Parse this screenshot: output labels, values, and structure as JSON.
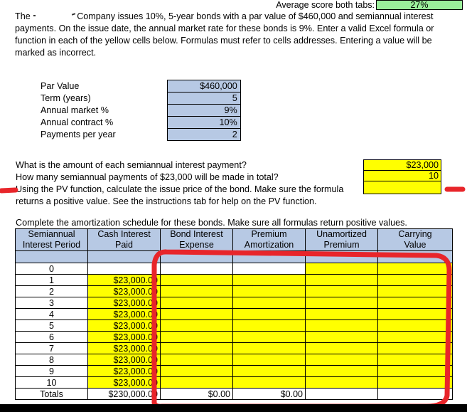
{
  "score_strip": {
    "label": "Average score both tabs:",
    "value": "27%",
    "cell_color": "#9bf09b"
  },
  "intro": {
    "before_name": "The",
    "company_name": "",
    "after_name": "Company issues 10%, 5-year bonds with a par value of $460,000 and semiannual interest payments.  On the issue date, the annual market rate for these bonds is 9%.  Enter a valid Excel formula or function in each of the yellow cells below.  Formulas must refer to cells addresses.  Entering a value will be marked as incorrect."
  },
  "inputs": {
    "rows": [
      {
        "label": "Par Value",
        "value": "$460,000"
      },
      {
        "label": "Term (years)",
        "value": "5"
      },
      {
        "label": "Annual market %",
        "value": "9%"
      },
      {
        "label": "Annual contract %",
        "value": "10%"
      },
      {
        "label": "Payments per year",
        "value": "2"
      }
    ],
    "cell_color": "#b7c9e4"
  },
  "questions": {
    "q1": "What is the amount of each semiannual interest payment?",
    "q2": "How many semiannual payments of $23,000 will be made in total?",
    "q3": "Using the PV function, calculate the issue price of the bond.  Make sure the formula returns a positive value.  See the instructions tab for help on the PV function.",
    "a1": "$23,000",
    "a2": "10",
    "a3": "",
    "cell_color": "#ffff00"
  },
  "amortization": {
    "heading": "Complete the amortization schedule for these bonds.  Make sure all formulas return positive values.",
    "columns": [
      "Semiannual Interest Period",
      "Cash Interest Paid",
      "Bond Interest Expense",
      "Premium Amortization",
      "Unamortized Premium",
      "Carrying Value"
    ],
    "columns_line1": [
      "Semiannual",
      "Cash Interest",
      "Bond Interest",
      "Premium",
      "Unamortized",
      "Carrying"
    ],
    "columns_line2": [
      "Interest Period",
      "Paid",
      "Expense",
      "Amortization",
      "Premium",
      "Value"
    ],
    "rows": [
      {
        "period": "0",
        "cash": "",
        "expense": "",
        "amort": "",
        "unamort": "",
        "carrying": ""
      },
      {
        "period": "1",
        "cash": "$23,000.00",
        "expense": "",
        "amort": "",
        "unamort": "",
        "carrying": ""
      },
      {
        "period": "2",
        "cash": "$23,000.00",
        "expense": "",
        "amort": "",
        "unamort": "",
        "carrying": ""
      },
      {
        "period": "3",
        "cash": "$23,000.00",
        "expense": "",
        "amort": "",
        "unamort": "",
        "carrying": ""
      },
      {
        "period": "4",
        "cash": "$23,000.00",
        "expense": "",
        "amort": "",
        "unamort": "",
        "carrying": ""
      },
      {
        "period": "5",
        "cash": "$23,000.00",
        "expense": "",
        "amort": "",
        "unamort": "",
        "carrying": ""
      },
      {
        "period": "6",
        "cash": "$23,000.00",
        "expense": "",
        "amort": "",
        "unamort": "",
        "carrying": ""
      },
      {
        "period": "7",
        "cash": "$23,000.00",
        "expense": "",
        "amort": "",
        "unamort": "",
        "carrying": ""
      },
      {
        "period": "8",
        "cash": "$23,000.00",
        "expense": "",
        "amort": "",
        "unamort": "",
        "carrying": ""
      },
      {
        "period": "9",
        "cash": "$23,000.00",
        "expense": "",
        "amort": "",
        "unamort": "",
        "carrying": ""
      },
      {
        "period": "10",
        "cash": "$23,000.00",
        "expense": "",
        "amort": "",
        "unamort": "",
        "carrying": ""
      }
    ],
    "totals": {
      "label": "Totals",
      "cash": "$230,000.00",
      "expense": "$0.00",
      "amort": "$0.00",
      "unamort": "",
      "carrying": ""
    },
    "header_color": "#b7c9e4",
    "input_cell_color": "#ffff00"
  },
  "annotations": {
    "color": "#e8252a",
    "marks": [
      "left-dash",
      "right-dash",
      "rounded-rectangle-outline"
    ]
  }
}
